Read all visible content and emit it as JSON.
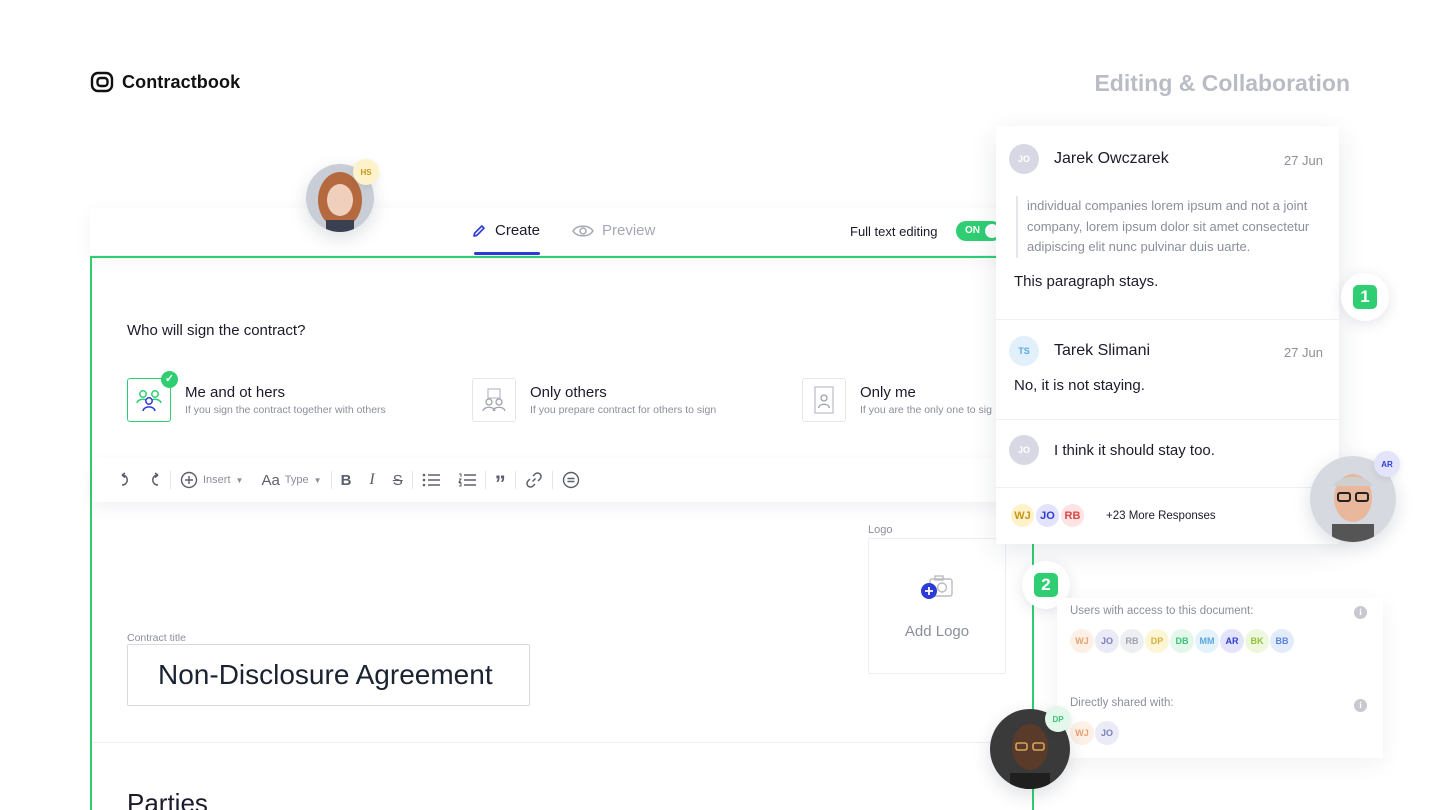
{
  "brand": {
    "name": "Contractbook"
  },
  "page_heading": "Editing & Collaboration",
  "editor": {
    "tabs": {
      "create": "Create",
      "preview": "Preview"
    },
    "full_text_label": "Full text editing",
    "toggle_label": "ON",
    "question": "Who will sign the contract?",
    "options": [
      {
        "title": "Me and ot hers",
        "subtitle": "If you sign the contract together with others",
        "selected": true
      },
      {
        "title": "Only others",
        "subtitle": "If you prepare contract for others to sign",
        "selected": false
      },
      {
        "title": "Only me",
        "subtitle": "If you are the only one to sig",
        "selected": false
      }
    ],
    "toolbar": {
      "insert": "Insert",
      "type_prefix": "Aa",
      "type": "Type",
      "bold": "B",
      "italic": "I",
      "strike": "S",
      "quote": "”"
    },
    "logo_label": "Logo",
    "add_logo": "Add Logo",
    "contract_title_label": "Contract title",
    "contract_title": "Non-Disclosure Agreement",
    "parties_heading": "Parties"
  },
  "comments": {
    "thread": [
      {
        "initials": "JO",
        "name": "Jarek Owczarek",
        "date": "27 Jun",
        "quote": "individual companies lorem ipsum and not a joint company, lorem ipsum dolor sit amet consectetur adipiscing elit nunc pulvinar duis uarte.",
        "text": "This paragraph stays."
      },
      {
        "initials": "TS",
        "name": "Tarek Slimani",
        "date": "27 Jun",
        "text": "No, it is not staying."
      },
      {
        "initials": "JO",
        "text": "I think it should stay too."
      }
    ],
    "responders": [
      "WJ",
      "JO",
      "RB"
    ],
    "more_responses": "+23 More Responses"
  },
  "badges": {
    "first": "1",
    "second": "2"
  },
  "access": {
    "users_label": "Users with access to this document:",
    "users": [
      "WJ",
      "JO",
      "RB",
      "DP",
      "DB",
      "MM",
      "AR",
      "BK",
      "BB"
    ],
    "shared_label": "Directly shared with:",
    "shared": [
      "WJ",
      "JO"
    ]
  },
  "photo_tags": {
    "top_left": "HS",
    "right": "AR",
    "bottom": "DP"
  },
  "colors": {
    "accent_green": "#2fce73",
    "accent_blue": "#2d3bd6",
    "muted_heading": "#b9bcc4"
  }
}
